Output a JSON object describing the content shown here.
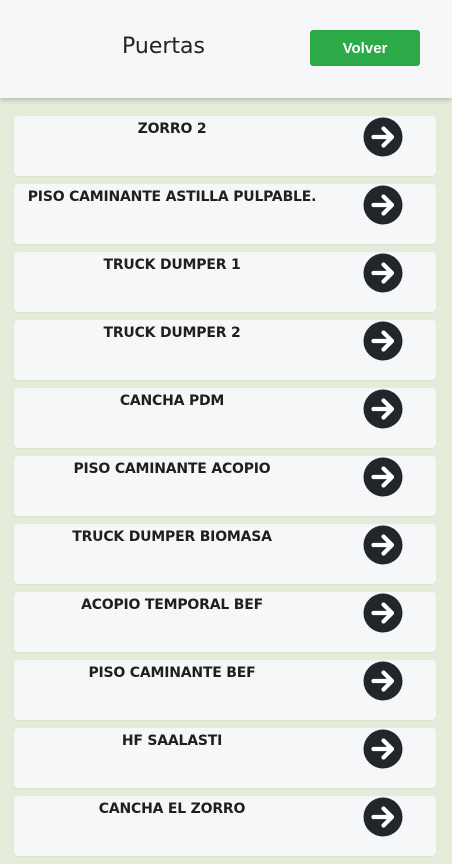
{
  "header": {
    "title": "Puertas",
    "back_label": "Volver"
  },
  "colors": {
    "page_background": "#e4ecda",
    "header_background": "#f6f7f9",
    "button_green": "#2daa48",
    "icon_dark": "#22262b"
  },
  "doors": [
    {
      "label": "ZORRO 2",
      "icon": "arrow-right-circle-icon"
    },
    {
      "label": "PISO CAMINANTE ASTILLA PULPABLE.",
      "icon": "arrow-right-circle-icon"
    },
    {
      "label": "TRUCK DUMPER 1",
      "icon": "arrow-right-circle-icon"
    },
    {
      "label": "TRUCK DUMPER 2",
      "icon": "arrow-right-circle-icon"
    },
    {
      "label": "CANCHA PDM",
      "icon": "arrow-right-circle-icon"
    },
    {
      "label": "PISO CAMINANTE ACOPIO",
      "icon": "arrow-right-circle-icon"
    },
    {
      "label": "TRUCK DUMPER BIOMASA",
      "icon": "arrow-right-circle-icon"
    },
    {
      "label": "ACOPIO TEMPORAL BEF",
      "icon": "arrow-right-circle-icon"
    },
    {
      "label": "PISO CAMINANTE BEF",
      "icon": "arrow-right-circle-icon"
    },
    {
      "label": "HF SAALASTI",
      "icon": "arrow-right-circle-icon"
    },
    {
      "label": "CANCHA EL ZORRO",
      "icon": "arrow-right-circle-icon"
    }
  ]
}
